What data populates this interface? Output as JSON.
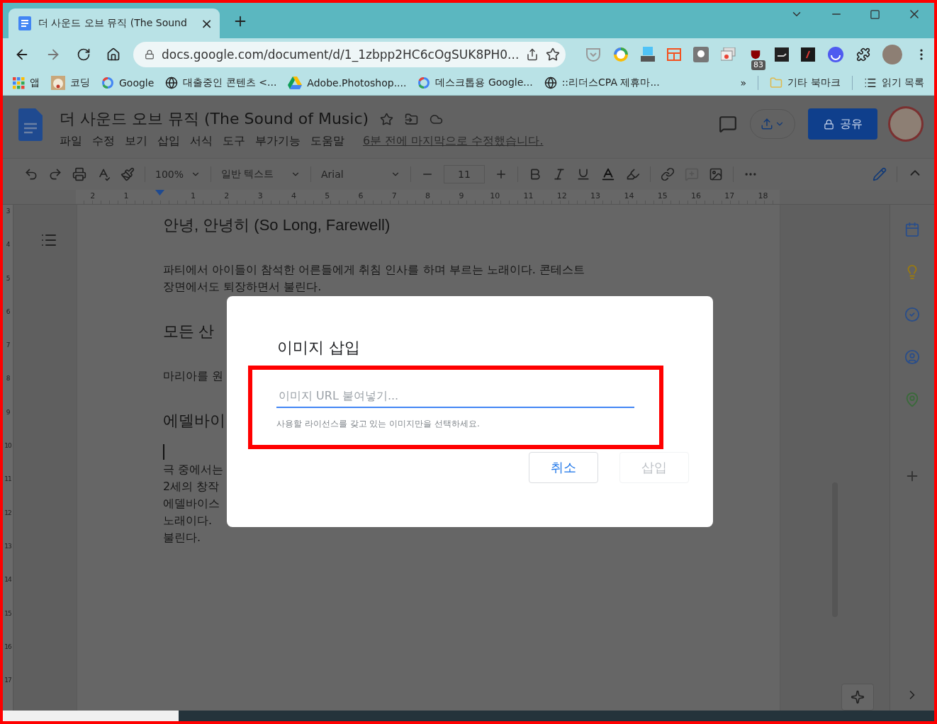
{
  "browser": {
    "tab": {
      "title": "더 사운드 오브 뮤직 (The Sound",
      "close": "×"
    },
    "address": "docs.google.com/document/d/1_1zbpp2HC6cOgSUK8PH0...",
    "extension_badge": "83",
    "bookmarks": [
      {
        "kind": "apps",
        "label": "앱"
      },
      {
        "label": "코딩"
      },
      {
        "kind": "g",
        "label": "Google"
      },
      {
        "kind": "globe",
        "label": "대출중인 콘텐츠 <..."
      },
      {
        "kind": "drive",
        "label": "Adobe.Photoshop...."
      },
      {
        "kind": "g",
        "label": "데스크톱용 Google..."
      },
      {
        "kind": "globe",
        "label": "::리더스CPA 제휴마..."
      }
    ],
    "more": "»",
    "other_bookmarks": "기타 북마크",
    "reading_list": "읽기 목록"
  },
  "docs": {
    "title": "더 사운드 오브 뮤직 (The Sound of Music)",
    "menu": [
      "파일",
      "수정",
      "보기",
      "삽입",
      "서식",
      "도구",
      "부가기능",
      "도움말"
    ],
    "last_edit": "6분 전에 마지막으로 수정했습니다.",
    "share": "공유",
    "toolbar": {
      "zoom": "100%",
      "style": "일반 텍스트",
      "font": "Arial",
      "size": "11"
    },
    "ruler": {
      "left_labels": [
        "2",
        "1"
      ],
      "right_labels": [
        "1",
        "2",
        "3",
        "4",
        "5",
        "6",
        "7",
        "8",
        "9",
        "10",
        "11",
        "12",
        "13",
        "14",
        "15",
        "16",
        "17",
        "18"
      ]
    },
    "vertical_ruler": [
      "3",
      "4",
      "5",
      "6",
      "7",
      "8",
      "9",
      "10",
      "11",
      "12",
      "13",
      "14",
      "15",
      "16",
      "17"
    ],
    "content": [
      {
        "kind": "heading",
        "lines": [
          "안녕, 안녕히 (So Long, Farewell)"
        ]
      },
      {
        "kind": "paragraph",
        "lines": [
          "파티에서 아이들이 참석한 어른들에게 취침 인사를 하며 부르는 노래이다. 콘테스트",
          "장면에서도 퇴장하면서 불린다."
        ]
      },
      {
        "kind": "heading",
        "lines": [
          "모든 산"
        ]
      },
      {
        "kind": "paragraph",
        "lines": [
          "마리아를 원"
        ]
      },
      {
        "kind": "heading",
        "lines": [
          "에델바이"
        ]
      },
      {
        "kind": "cursor"
      },
      {
        "kind": "paragraph",
        "lines": [
          "극 중에서는",
          "2세의 창작",
          "에델바이스",
          "노래이다.",
          "불린다."
        ]
      }
    ]
  },
  "dialog": {
    "title": "이미지 삽입",
    "placeholder": "이미지 URL 붙여넣기...",
    "hint": "사용할 라이선스를 갖고 있는 이미지만을 선택하세요.",
    "buttons": [
      {
        "label": "취소",
        "disabled": false
      },
      {
        "label": "삽입",
        "disabled": true
      }
    ]
  }
}
